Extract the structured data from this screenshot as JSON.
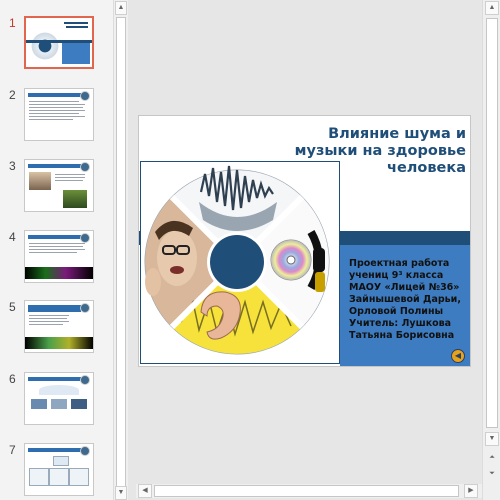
{
  "slides": [
    {
      "number": "1",
      "active": true
    },
    {
      "number": "2"
    },
    {
      "number": "3"
    },
    {
      "number": "4"
    },
    {
      "number": "5"
    },
    {
      "number": "6"
    },
    {
      "number": "7"
    }
  ],
  "slide": {
    "title": "Влияние шума и музыки на здоровье человека",
    "info": "Проектная работа\nучениц 9³ класса\nМАОУ «Лицей №36»\nЗайнышевой Дарьи,\nОрловой Полины\nУчитель: Лушкова\nТатьяна Борисовна"
  },
  "colors": {
    "accent": "#1f4e79",
    "info_box": "#3d7cc0",
    "active_thumb_border": "#e2664d"
  },
  "icons": {
    "scroll_up": "triangle-up-icon",
    "scroll_down": "triangle-down-icon",
    "prev_slide": "double-up-icon",
    "next_slide": "double-down-icon",
    "sound": "speaker-icon"
  }
}
